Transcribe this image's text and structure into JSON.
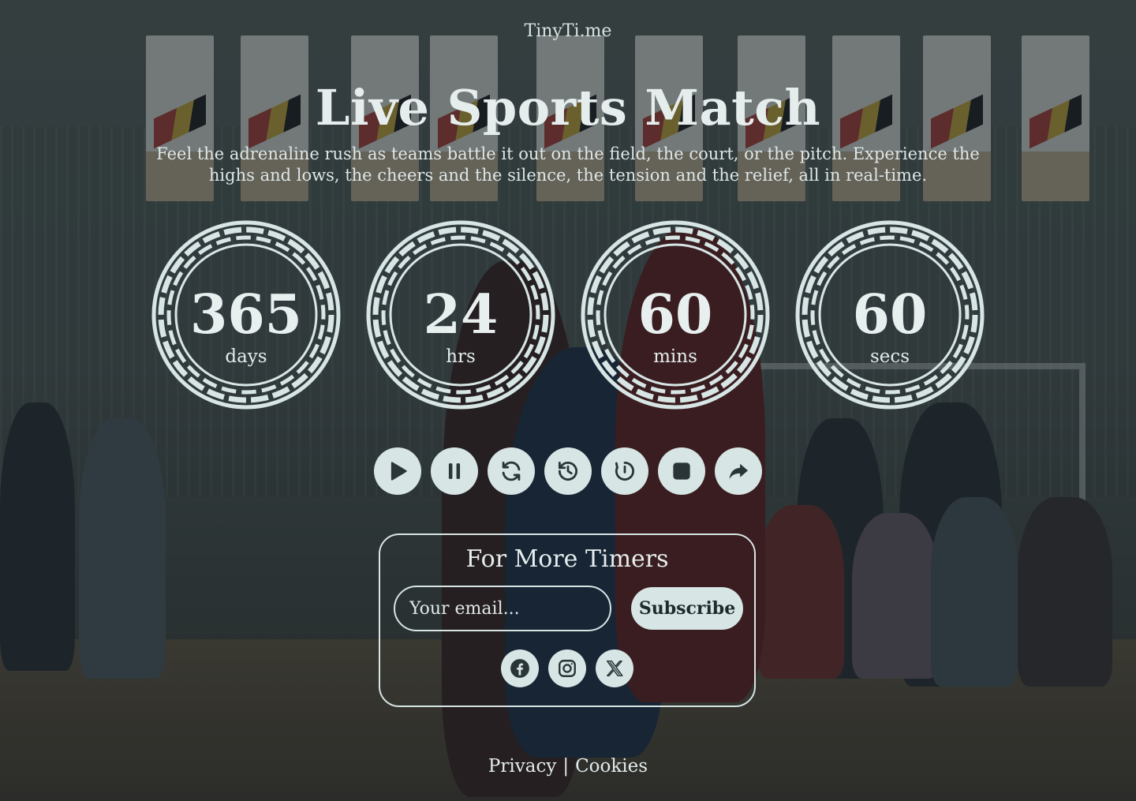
{
  "brand": "TinyTi.me",
  "title": "Live Sports Match",
  "description": "Feel the adrenaline rush as teams battle it out on the field, the court, or the pitch. Experience the highs and lows, the cheers and the silence, the tension and the relief, all in real-time.",
  "timers": [
    {
      "value": "365",
      "unit": "days"
    },
    {
      "value": "24",
      "unit": "hrs"
    },
    {
      "value": "60",
      "unit": "mins"
    },
    {
      "value": "60",
      "unit": "secs"
    }
  ],
  "controls": [
    "play-icon",
    "pause-icon",
    "restart-icon",
    "rewind-icon",
    "reset-icon",
    "stop-icon",
    "share-icon"
  ],
  "subscribe": {
    "heading": "For More Timers",
    "placeholder": "Your email...",
    "button": "Subscribe"
  },
  "social": [
    "facebook-icon",
    "instagram-icon",
    "x-icon"
  ],
  "footer": {
    "privacy": "Privacy",
    "separator": "|",
    "cookies": "Cookies"
  },
  "colors": {
    "accent": "#d7e5e5",
    "text": "#e6eded",
    "icon": "#2a3538"
  }
}
